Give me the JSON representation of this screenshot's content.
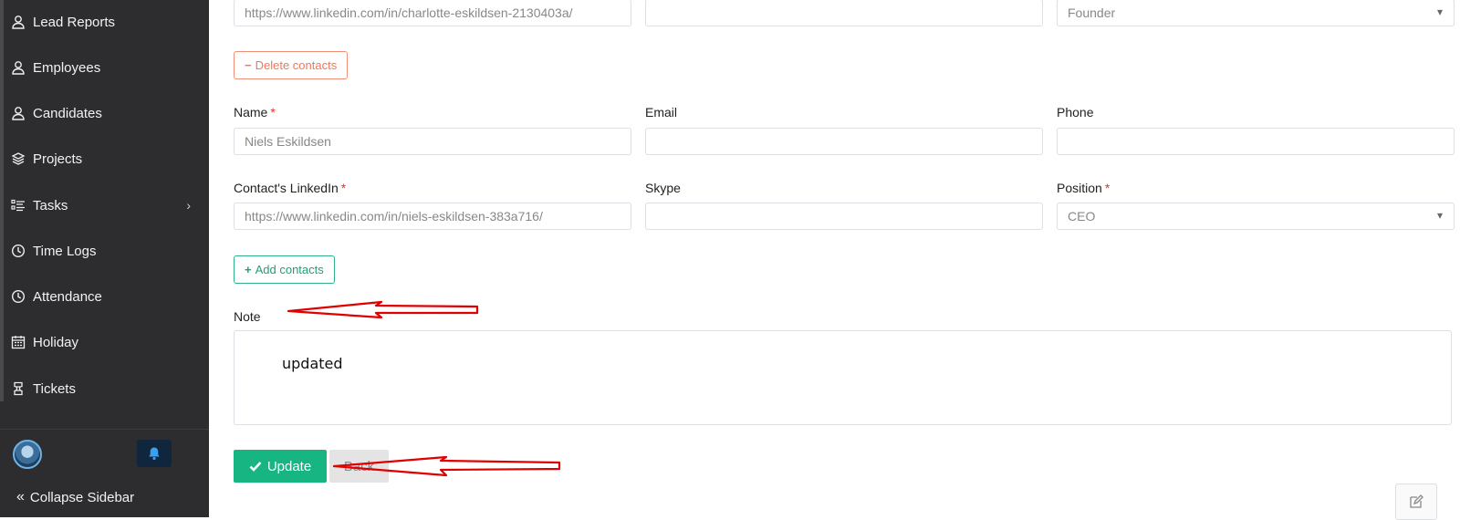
{
  "sidebar": {
    "items": [
      {
        "label": "Lead Reports",
        "icon": "user-icon"
      },
      {
        "label": "Employees",
        "icon": "user-icon"
      },
      {
        "label": "Candidates",
        "icon": "user-icon"
      },
      {
        "label": "Projects",
        "icon": "layers-icon"
      },
      {
        "label": "Tasks",
        "icon": "list-icon"
      },
      {
        "label": "Time Logs",
        "icon": "clock-icon"
      },
      {
        "label": "Attendance",
        "icon": "clock-icon"
      },
      {
        "label": "Holiday",
        "icon": "calendar-icon"
      },
      {
        "label": "Tickets",
        "icon": "ticket-icon"
      }
    ],
    "collapse_label": "Collapse Sidebar"
  },
  "contact1": {
    "linkedin_value": "https://www.linkedin.com/in/charlotte-eskildsen-2130403a/",
    "skype_value": "",
    "position_value": "Founder"
  },
  "delete_contacts_label": "Delete contacts",
  "contact2": {
    "name_label": "Name",
    "name_value": "Niels Eskildsen",
    "email_label": "Email",
    "email_value": "",
    "phone_label": "Phone",
    "phone_value": "",
    "linkedin_label": "Contact's LinkedIn",
    "linkedin_value": "https://www.linkedin.com/in/niels-eskildsen-383a716/",
    "skype_label": "Skype",
    "skype_value": "",
    "position_label": "Position",
    "position_value": "CEO"
  },
  "required_mark": "*",
  "add_contacts_label": "Add contacts",
  "note": {
    "label": "Note",
    "value": "updated"
  },
  "actions": {
    "update_label": "Update",
    "back_label": "Back"
  },
  "colors": {
    "sidebar_bg": "#2d2d2f",
    "primary": "#17b582",
    "danger": "#f0775c",
    "annotation_arrow": "#e00000"
  }
}
